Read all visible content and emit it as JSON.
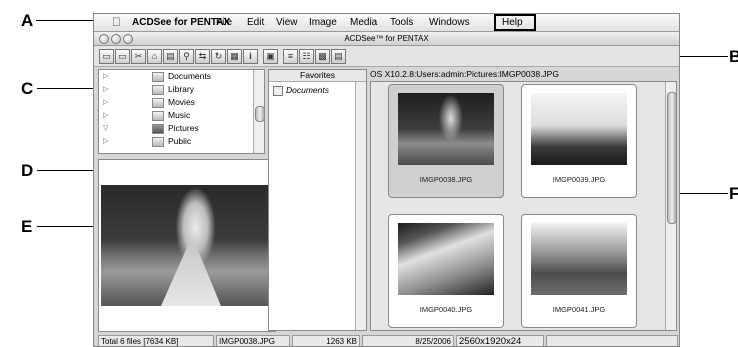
{
  "menubar": {
    "app_name": "ACDSee for PENTAX",
    "items": [
      "File",
      "Edit",
      "View",
      "Image",
      "Media",
      "Tools",
      "Windows",
      "Help"
    ]
  },
  "window": {
    "title": "ACDSee™ for PENTAX"
  },
  "toolbar": {
    "icons": [
      "paste-icon",
      "copy-icon",
      "cut-icon",
      "folder-up-icon",
      "move-icon",
      "search-icon",
      "share-icon",
      "rotate-icon",
      "properties-icon",
      "info-icon",
      "view-icon",
      "list-icon",
      "details-icon",
      "thumbnails-icon",
      "sort-icon"
    ]
  },
  "folder_tree": {
    "items": [
      {
        "label": "Documents",
        "expanded": false
      },
      {
        "label": "Library",
        "expanded": false
      },
      {
        "label": "Movies",
        "expanded": false
      },
      {
        "label": "Music",
        "expanded": false
      },
      {
        "label": "Pictures",
        "expanded": true
      },
      {
        "label": "Public",
        "expanded": false
      }
    ]
  },
  "favorites": {
    "header": "Favorites",
    "items": [
      "Documents"
    ]
  },
  "path_bar": {
    "path": "OS X10.2.8:Users:admin:Pictures:IMGP0038.JPG"
  },
  "thumbnails": [
    {
      "filename": "IMGP0038.JPG",
      "selected": true
    },
    {
      "filename": "IMGP0039.JPG",
      "selected": false
    },
    {
      "filename": "IMGP0040.JPG",
      "selected": false
    },
    {
      "filename": "IMGP0041.JPG",
      "selected": false
    }
  ],
  "status_bar": {
    "total": "Total 6 files [7634 KB]",
    "filename": "IMGP0038.JPG",
    "size": "1263 KB",
    "date": "8/25/2006",
    "dimensions": "2560x1920x24"
  },
  "callouts": {
    "A": "A",
    "B": "B",
    "C": "C",
    "D": "D",
    "E": "E",
    "F": "F"
  }
}
